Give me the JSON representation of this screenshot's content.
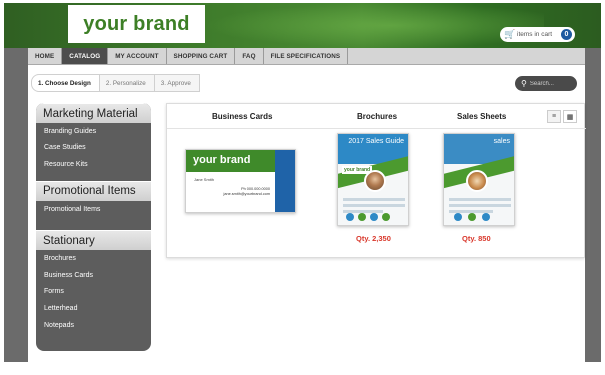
{
  "header": {
    "brand": "your brand",
    "cart_label": "items in cart",
    "cart_count": "0"
  },
  "nav": {
    "items": [
      {
        "label": "HOME"
      },
      {
        "label": "CATALOG"
      },
      {
        "label": "MY ACCOUNT"
      },
      {
        "label": "SHOPPING CART"
      },
      {
        "label": "FAQ"
      },
      {
        "label": "FILE SPECIFICATIONS"
      }
    ],
    "active": "CATALOG"
  },
  "steps": [
    {
      "label": "1. Choose Design"
    },
    {
      "label": "2. Personalize"
    },
    {
      "label": "3. Approve"
    }
  ],
  "search": {
    "placeholder": "Search..."
  },
  "sidebar": {
    "sections": [
      {
        "title": "Marketing Material",
        "items": [
          "Branding Guides",
          "Case Studies",
          "Resource Kits"
        ]
      },
      {
        "title": "Promotional Items",
        "items": [
          "Promotional Items"
        ]
      },
      {
        "title": "Stationary",
        "items": [
          "Brochures",
          "Business Cards",
          "Forms",
          "Letterhead",
          "Notepads"
        ]
      }
    ]
  },
  "columns": {
    "business_cards": "Business Cards",
    "brochures": "Brochures",
    "sales_sheets": "Sales Sheets"
  },
  "products": {
    "business_card": {
      "brand": "your brand",
      "name": "Jane Smith",
      "title": "Ph 000.000.0000",
      "email": "jane.smith@yourbrand.com"
    },
    "brochure": {
      "thumb_title": "2017 Sales Guide",
      "tag": "your brand",
      "qty": "Qty. 2,350"
    },
    "sales_sheet": {
      "thumb_title": "sales",
      "qty": "Qty. 850"
    }
  },
  "colors": {
    "brand_green": "#3d7f26",
    "accent_blue": "#1e5aa0",
    "qty_red": "#d9372b"
  }
}
